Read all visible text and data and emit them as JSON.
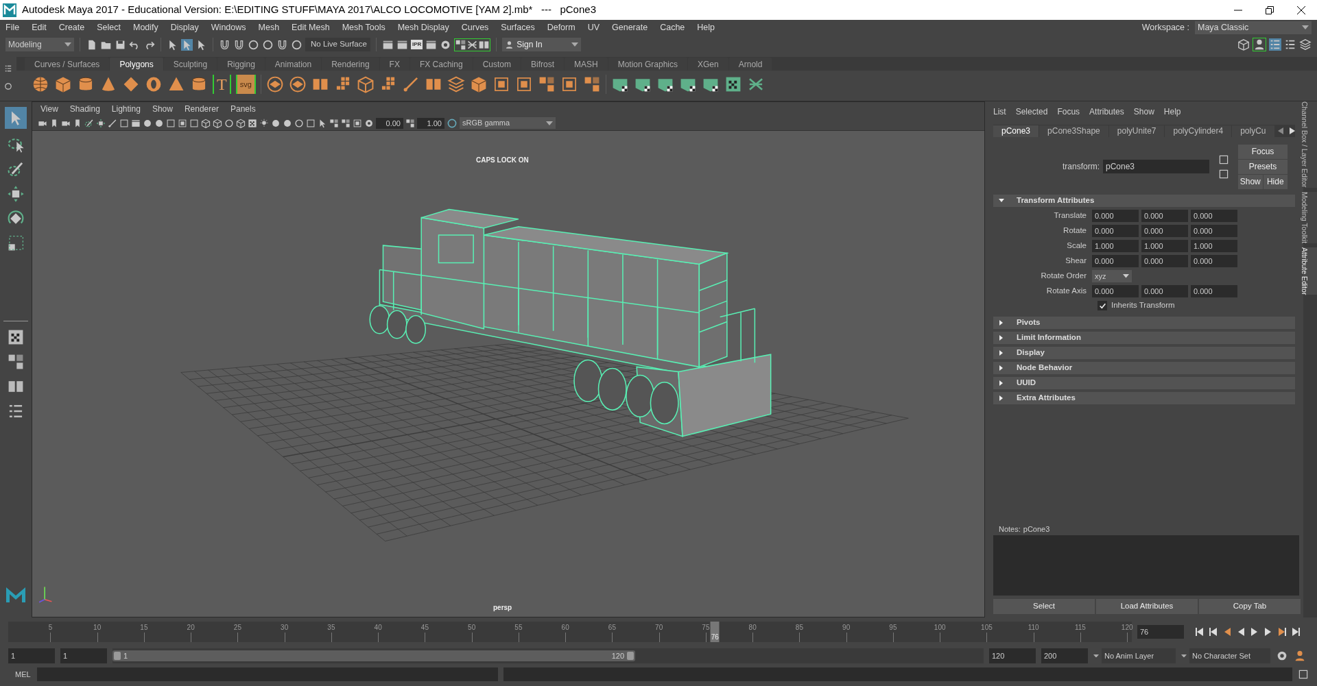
{
  "window": {
    "title": "Autodesk Maya 2017 - Educational Version: E:\\EDITING STUFF\\MAYA 2017\\ALCO LOCOMOTIVE [YAM 2].mb*   ---   pCone3"
  },
  "menu_bar": [
    "File",
    "Edit",
    "Create",
    "Select",
    "Modify",
    "Display",
    "Windows",
    "Mesh",
    "Edit Mesh",
    "Mesh Tools",
    "Mesh Display",
    "Curves",
    "Surfaces",
    "Deform",
    "UV",
    "Generate",
    "Cache",
    "Help"
  ],
  "workspace": {
    "label": "Workspace :",
    "value": "Maya Classic"
  },
  "status_line": {
    "mode": "Modeling",
    "live_surface": "No Live Surface",
    "ipr_label": "IPR",
    "sign_in": "Sign In"
  },
  "shelf_tabs": [
    {
      "label": "Curves / Surfaces",
      "selected": false
    },
    {
      "label": "Polygons",
      "selected": true
    },
    {
      "label": "Sculpting",
      "selected": false
    },
    {
      "label": "Rigging",
      "selected": false
    },
    {
      "label": "Animation",
      "selected": false
    },
    {
      "label": "Rendering",
      "selected": false
    },
    {
      "label": "FX",
      "selected": false
    },
    {
      "label": "FX Caching",
      "selected": false
    },
    {
      "label": "Custom",
      "selected": false
    },
    {
      "label": "Bifrost",
      "selected": false
    },
    {
      "label": "MASH",
      "selected": false
    },
    {
      "label": "Motion Graphics",
      "selected": false
    },
    {
      "label": "XGen",
      "selected": false
    },
    {
      "label": "Arnold",
      "selected": false
    }
  ],
  "shelf": {
    "text_tool": "T",
    "svg_tool": "svg"
  },
  "viewport": {
    "menu": [
      "View",
      "Shading",
      "Lighting",
      "Show",
      "Renderer",
      "Panels"
    ],
    "exposure": "0.00",
    "gamma": "1.00",
    "color_space": "sRGB gamma",
    "hud": "CAPS LOCK ON",
    "camera": "persp"
  },
  "attribute_editor": {
    "menu": [
      "List",
      "Selected",
      "Focus",
      "Attributes",
      "Show",
      "Help"
    ],
    "tabs": [
      {
        "label": "pCone3",
        "selected": true
      },
      {
        "label": "pCone3Shape",
        "selected": false
      },
      {
        "label": "polyUnite7",
        "selected": false
      },
      {
        "label": "polyCylinder4",
        "selected": false
      },
      {
        "label": "polyCu",
        "selected": false
      }
    ],
    "node_label": "transform:",
    "node_value": "pCone3",
    "side_buttons": [
      "Focus",
      "Presets",
      "Show",
      "Hide"
    ],
    "transform_section": {
      "title": "Transform Attributes",
      "expanded": true
    },
    "rows": [
      {
        "kind": "vector",
        "label": "Translate",
        "values": [
          "0.000",
          "0.000",
          "0.000"
        ]
      },
      {
        "kind": "vector",
        "label": "Rotate",
        "values": [
          "0.000",
          "0.000",
          "0.000"
        ]
      },
      {
        "kind": "vector",
        "label": "Scale",
        "values": [
          "1.000",
          "1.000",
          "1.000"
        ]
      },
      {
        "kind": "vector",
        "label": "Shear",
        "values": [
          "0.000",
          "0.000",
          "0.000"
        ]
      },
      {
        "kind": "dropdown",
        "label": "Rotate Order",
        "value": "xyz"
      },
      {
        "kind": "vector",
        "label": "Rotate Axis",
        "values": [
          "0.000",
          "0.000",
          "0.000"
        ]
      },
      {
        "kind": "checkbox",
        "label": "Inherits Transform",
        "checked": true
      }
    ],
    "sections": [
      {
        "title": "Pivots",
        "expanded": false
      },
      {
        "title": "Limit Information",
        "expanded": false
      },
      {
        "title": "Display",
        "expanded": false
      },
      {
        "title": "Node Behavior",
        "expanded": false
      },
      {
        "title": "UUID",
        "expanded": false
      },
      {
        "title": "Extra Attributes",
        "expanded": false
      }
    ],
    "notes_label": "Notes:",
    "notes_value": "pCone3",
    "bottom_buttons": [
      "Select",
      "Load Attributes",
      "Copy Tab"
    ]
  },
  "side_tabs": [
    {
      "label": "Channel Box / Layer Editor",
      "selected": false
    },
    {
      "label": "Modeling Toolkit",
      "selected": false
    },
    {
      "label": "Attribute Editor",
      "selected": true
    }
  ],
  "time_slider": {
    "ticks": [
      "5",
      "10",
      "15",
      "20",
      "25",
      "30",
      "35",
      "40",
      "45",
      "50",
      "55",
      "60",
      "65",
      "70",
      "75",
      "80",
      "85",
      "90",
      "95",
      "100",
      "105",
      "110",
      "115",
      "120"
    ],
    "current": "76",
    "level": 0.629,
    "current_field": "76"
  },
  "range_slider": {
    "start": "1",
    "playback_start": "1",
    "range_start": "1",
    "range_end": "120",
    "level": 0.6,
    "playback_end": "120",
    "end": "200",
    "anim_layer": "No Anim Layer",
    "character_set": "No Character Set"
  },
  "command_line": {
    "language": "MEL"
  }
}
